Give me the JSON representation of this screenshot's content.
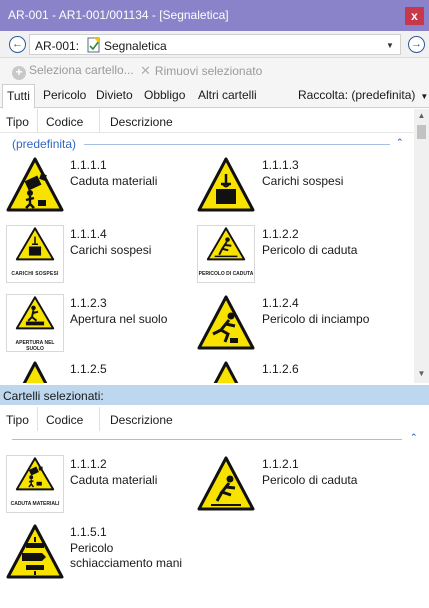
{
  "window": {
    "title": "AR-001 - AR1-001/001134 - [Segnaletica]",
    "close_glyph": "x"
  },
  "address": {
    "back_glyph": "←",
    "forward_glyph": "→",
    "prefix": "AR-001:",
    "value": "Segnaletica",
    "dropdown_glyph": "▼"
  },
  "toolbar": {
    "add_label": "Seleziona cartello...",
    "add_glyph": "+",
    "remove_label": "Rimuovi selezionato",
    "remove_glyph": "✕"
  },
  "tabs": [
    {
      "label": "Tutti"
    },
    {
      "label": "Pericolo"
    },
    {
      "label": "Divieto"
    },
    {
      "label": "Obbligo"
    },
    {
      "label": "Altri cartelli"
    }
  ],
  "collection": {
    "label": "Raccolta: (predefinita)",
    "caret": "▼"
  },
  "columns": {
    "type": "Tipo",
    "code": "Codice",
    "description": "Descrizione"
  },
  "catalog": {
    "group": "(predefinita)",
    "collapse_glyph": "⌃",
    "items": [
      {
        "code": "1.1.1.1",
        "description": "Caduta materiali",
        "icon": "falling-materials-icon",
        "caption": ""
      },
      {
        "code": "1.1.1.3",
        "description": "Carichi sospesi",
        "icon": "suspended-loads-icon",
        "caption": ""
      },
      {
        "code": "1.1.1.4",
        "description": "Carichi sospesi",
        "icon": "suspended-loads-icon",
        "caption": "CARICHI SOSPESI"
      },
      {
        "code": "1.1.2.2",
        "description": "Pericolo di caduta",
        "icon": "fall-hazard-icon",
        "caption": "PERICOLO DI CADUTA"
      },
      {
        "code": "1.1.2.3",
        "description": "Apertura nel suolo",
        "icon": "floor-opening-icon",
        "caption": "APERTURA NEL SUOLO"
      },
      {
        "code": "1.1.2.4",
        "description": "Pericolo di inciampo",
        "icon": "trip-hazard-icon",
        "caption": ""
      },
      {
        "code": "1.1.2.5",
        "description": "",
        "icon": "warning-icon",
        "caption": ""
      },
      {
        "code": "1.1.2.6",
        "description": "",
        "icon": "warning-icon",
        "caption": ""
      }
    ]
  },
  "selected": {
    "header": "Cartelli selezionati:",
    "collapse_glyph": "⌃",
    "items": [
      {
        "code": "1.1.1.2",
        "description": "Caduta materiali",
        "icon": "falling-materials-icon",
        "caption": "CADUTA MATERIALI"
      },
      {
        "code": "1.1.2.1",
        "description": "Pericolo di caduta",
        "icon": "fall-hazard-icon",
        "caption": ""
      },
      {
        "code": "1.1.5.1",
        "description_line1": "Pericolo",
        "description_line2": "schiacciamento mani",
        "icon": "hand-crush-icon",
        "caption": ""
      }
    ]
  },
  "scrollbar": {
    "up_glyph": "▲",
    "down_glyph": "▼"
  },
  "colors": {
    "title_bar": "#8a83c9",
    "close_button": "#c7384b",
    "accent": "#2f67c7",
    "sign_yellow": "#f8e300",
    "selection_bar": "#bdd7ee"
  }
}
